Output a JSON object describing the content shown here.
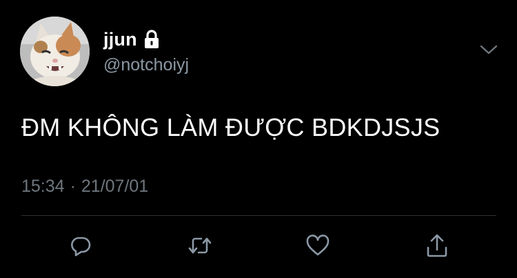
{
  "tweet": {
    "display_name": "jjun",
    "handle": "@notchoiyj",
    "text": "ĐM KHÔNG LÀM ĐƯỢC BDKDJSJS",
    "time": "15:34",
    "separator": "·",
    "date": "21/07/01",
    "verified_lock": true
  },
  "icons": {
    "avatar": "cat-avatar",
    "lock": "lock-icon",
    "menu": "chevron-down-icon",
    "reply": "reply-icon",
    "retweet": "retweet-icon",
    "like": "heart-icon",
    "share": "share-icon"
  },
  "colors": {
    "background": "#000000",
    "text": "#ffffff",
    "secondary": "#8b98a5",
    "muted": "#6e767d",
    "divider": "#2f3336",
    "icon": "#8b98a5"
  }
}
